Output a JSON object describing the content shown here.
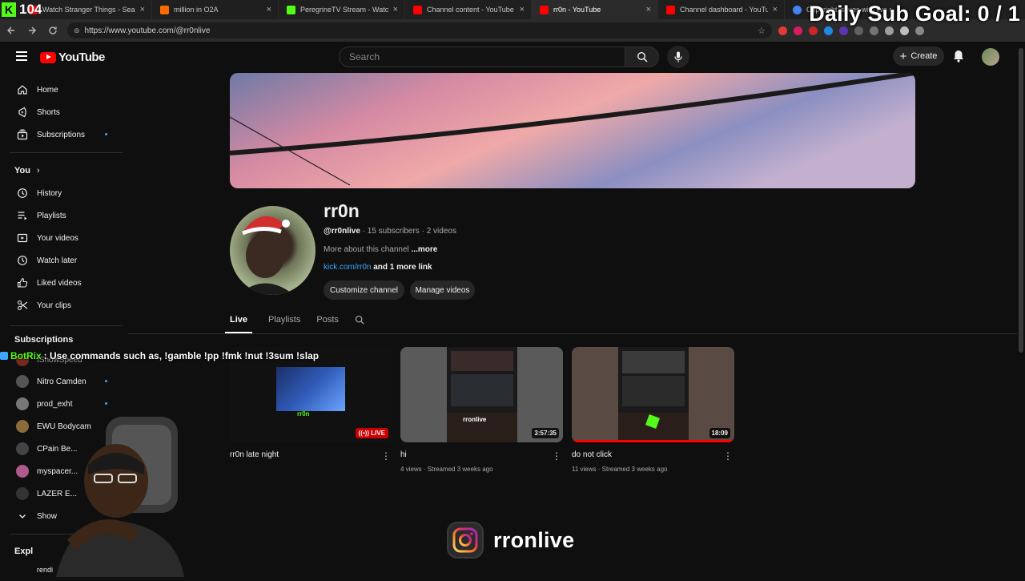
{
  "stream_overlay": {
    "kick_count": "104",
    "sub_goal": "Daily Sub Goal:  0 / 1",
    "botrix_user": "BotRix",
    "botrix_message": ": Use commands such as, !gamble !pp !fmk !nut !3sum !slap",
    "instagram_handle": "rronlive"
  },
  "browser": {
    "tabs": [
      {
        "title": "Watch Stranger Things - Season",
        "fav_color": "#e50914"
      },
      {
        "title": "million in O2A",
        "fav_color": "#ff6a00"
      },
      {
        "title": "PeregrineTV Stream - Watch Live",
        "fav_color": "#53fc18"
      },
      {
        "title": "Channel content - YouTube Studi",
        "fav_color": "#ff0000"
      },
      {
        "title": "rr0n - YouTube",
        "fav_color": "#ff0000"
      },
      {
        "title": "Channel dashboard - YouTube St",
        "fav_color": "#ff0000"
      },
      {
        "title": "Copyright issues with live stream",
        "fav_color": "#4285f4"
      }
    ],
    "url": "https://www.youtube.com/@rr0nlive"
  },
  "masthead": {
    "logo_text": "YouTube",
    "search_placeholder": "Search",
    "create_label": "Create"
  },
  "sidebar": {
    "main": [
      {
        "label": "Home",
        "icon": "home-icon"
      },
      {
        "label": "Shorts",
        "icon": "shorts-icon"
      },
      {
        "label": "Subscriptions",
        "icon": "subscriptions-icon"
      }
    ],
    "you_header": "You",
    "you": [
      {
        "label": "History",
        "icon": "history-icon"
      },
      {
        "label": "Playlists",
        "icon": "playlists-icon"
      },
      {
        "label": "Your videos",
        "icon": "your-videos-icon"
      },
      {
        "label": "Watch later",
        "icon": "watch-later-icon"
      },
      {
        "label": "Liked videos",
        "icon": "liked-icon"
      },
      {
        "label": "Your clips",
        "icon": "clips-icon"
      }
    ],
    "subs_header": "Subscriptions",
    "subs": [
      {
        "label": "IShowSpeed",
        "color": "#c0392b"
      },
      {
        "label": "Nitro Camden",
        "color": "#555"
      },
      {
        "label": "prod_exht",
        "color": "#777"
      },
      {
        "label": "EWU Bodycam",
        "color": "#8a6d3b"
      },
      {
        "label": "CPain Be...",
        "color": "#444"
      },
      {
        "label": "myspacer...",
        "color": "#b05a8c"
      },
      {
        "label": "LAZER E...",
        "color": "#333"
      }
    ],
    "show_more": "Show",
    "explore_header": "Expl",
    "partial_item": "rendi"
  },
  "channel": {
    "name": "rr0n",
    "handle": "@rr0nlive",
    "subscribers": "15 subscribers",
    "videos": "2 videos",
    "desc": "More about this channel",
    "more": "...more",
    "link": "kick.com/rr0n",
    "link_more": " and 1 more link",
    "customize_label": "Customize channel",
    "manage_label": "Manage videos",
    "tabs": [
      "Live",
      "Playlists",
      "Posts"
    ]
  },
  "videos": [
    {
      "title": "rr0n late night",
      "badge": "LIVE",
      "stats": ""
    },
    {
      "title": "hi",
      "duration": "3:57:35",
      "stats": "4 views · Streamed 3 weeks ago"
    },
    {
      "title": "do not click",
      "duration": "18:09",
      "stats": "11 views · Streamed 3 weeks ago"
    }
  ],
  "thumb_labels": {
    "v1": "rr0n",
    "v2": "rronlive"
  }
}
